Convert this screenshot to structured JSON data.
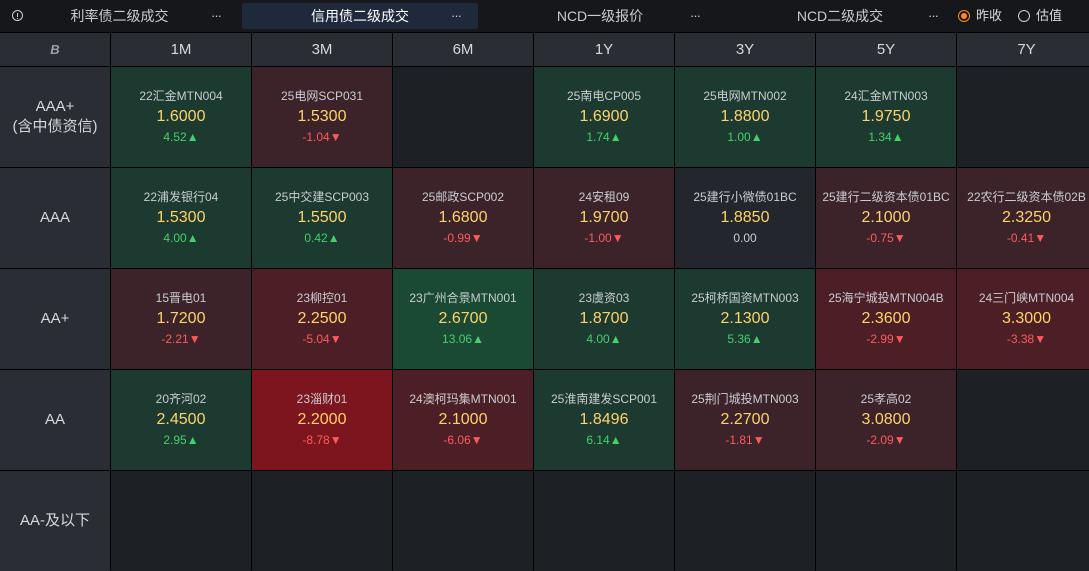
{
  "tabs": [
    {
      "label": "利率债二级成交",
      "active": false
    },
    {
      "label": "信用债二级成交",
      "active": true
    },
    {
      "label": "NCD一级报价",
      "active": false
    },
    {
      "label": "NCD二级成交",
      "active": false
    }
  ],
  "more_label": "···",
  "radios": [
    {
      "label": "昨收",
      "checked": true
    },
    {
      "label": "估值",
      "checked": false
    }
  ],
  "table": {
    "corner_icon": "B",
    "columns": [
      "1M",
      "3M",
      "6M",
      "1Y",
      "3Y",
      "5Y",
      "7Y"
    ],
    "rows": [
      {
        "label_line1": "AAA+",
        "label_line2": "(含中债资信)",
        "cells": [
          {
            "name": "22汇金MTN004",
            "yield": "1.6000",
            "change": "4.52▲",
            "dir": "up"
          },
          {
            "name": "25电网SCP031",
            "yield": "1.5300",
            "change": "-1.04▼",
            "dir": "down"
          },
          null,
          {
            "name": "25南电CP005",
            "yield": "1.6900",
            "change": "1.74▲",
            "dir": "up"
          },
          {
            "name": "25电网MTN002",
            "yield": "1.8800",
            "change": "1.00▲",
            "dir": "up"
          },
          {
            "name": "24汇金MTN003",
            "yield": "1.9750",
            "change": "1.34▲",
            "dir": "up"
          },
          null
        ]
      },
      {
        "label_line1": "AAA",
        "label_line2": "",
        "cells": [
          {
            "name": "22浦发银行04",
            "yield": "1.5300",
            "change": "4.00▲",
            "dir": "up"
          },
          {
            "name": "25中交建SCP003",
            "yield": "1.5500",
            "change": "0.42▲",
            "dir": "up"
          },
          {
            "name": "25邮政SCP002",
            "yield": "1.6800",
            "change": "-0.99▼",
            "dir": "down"
          },
          {
            "name": "24安租09",
            "yield": "1.9700",
            "change": "-1.00▼",
            "dir": "down"
          },
          {
            "name": "25建行小微债01BC",
            "yield": "1.8850",
            "change": "0.00",
            "dir": "flat"
          },
          {
            "name": "25建行二级资本债01BC",
            "yield": "2.1000",
            "change": "-0.75▼",
            "dir": "down"
          },
          {
            "name": "22农行二级资本债02B",
            "yield": "2.3250",
            "change": "-0.41▼",
            "dir": "down"
          }
        ]
      },
      {
        "label_line1": "AA+",
        "label_line2": "",
        "cells": [
          {
            "name": "15晋电01",
            "yield": "1.7200",
            "change": "-2.21▼",
            "dir": "down"
          },
          {
            "name": "23柳控01",
            "yield": "2.2500",
            "change": "-5.04▼",
            "dir": "down"
          },
          {
            "name": "23广州合景MTN001",
            "yield": "2.6700",
            "change": "13.06▲",
            "dir": "up"
          },
          {
            "name": "23虞资03",
            "yield": "1.8700",
            "change": "4.00▲",
            "dir": "up"
          },
          {
            "name": "25柯桥国资MTN003",
            "yield": "2.1300",
            "change": "5.36▲",
            "dir": "up"
          },
          {
            "name": "25海宁城投MTN004B",
            "yield": "2.3600",
            "change": "-2.99▼",
            "dir": "down"
          },
          {
            "name": "24三门峡MTN004",
            "yield": "3.3000",
            "change": "-3.38▼",
            "dir": "down"
          }
        ]
      },
      {
        "label_line1": "AA",
        "label_line2": "",
        "cells": [
          {
            "name": "20齐河02",
            "yield": "2.4500",
            "change": "2.95▲",
            "dir": "up"
          },
          {
            "name": "23淄财01",
            "yield": "2.2000",
            "change": "-8.78▼",
            "dir": "down"
          },
          {
            "name": "24澳柯玛集MTN001",
            "yield": "2.1000",
            "change": "-6.06▼",
            "dir": "down"
          },
          {
            "name": "25淮南建发SCP001",
            "yield": "1.8496",
            "change": "6.14▲",
            "dir": "up"
          },
          {
            "name": "25荆门城投MTN003",
            "yield": "2.2700",
            "change": "-1.81▼",
            "dir": "down"
          },
          {
            "name": "25孝高02",
            "yield": "3.0800",
            "change": "-2.09▼",
            "dir": "down"
          },
          null
        ]
      },
      {
        "label_line1": "AA-及以下",
        "label_line2": "",
        "cells": [
          null,
          null,
          null,
          null,
          null,
          null,
          null
        ]
      }
    ]
  }
}
